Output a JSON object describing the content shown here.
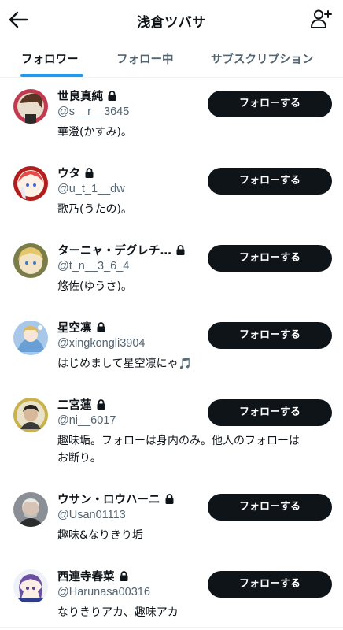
{
  "header": {
    "title": "浅倉ツバサ",
    "back_icon": "arrow-left-icon",
    "add_icon": "person-add-icon"
  },
  "tabs": [
    {
      "label": "フォロワー",
      "active": true
    },
    {
      "label": "フォロー中",
      "active": false
    },
    {
      "label": "サブスクリプション",
      "active": false
    }
  ],
  "colors": {
    "accent": "#1d9bf0",
    "button_bg": "#0f1419",
    "secondary_text": "#536471"
  },
  "users": [
    {
      "name": "世良真純",
      "handle": "@s__r__3645",
      "bio": [
        "華澄(かすみ)。"
      ],
      "button": "フォローする",
      "protected": true
    },
    {
      "name": "ウタ",
      "handle": "@u_t_1__dw",
      "bio": [
        "歌乃(うたの)。"
      ],
      "button": "フォローする",
      "protected": true
    },
    {
      "name": "ターニャ・デグレチ…",
      "handle": "@t_n__3_6_4",
      "bio": [
        "悠佐(ゆうさ)。"
      ],
      "button": "フォローする",
      "protected": true
    },
    {
      "name": "星空凛",
      "handle": "@xingkongli3904",
      "bio": [
        "はじめまして星空凛にゃ🎵"
      ],
      "button": "フォローする",
      "protected": true
    },
    {
      "name": "二宮蓮",
      "handle": "@ni__6017",
      "bio": [
        "趣味垢。フォローは身内のみ。他人のフォローは",
        "お断り。"
      ],
      "button": "フォローする",
      "protected": true
    },
    {
      "name": "ウサン・ロウハーニ",
      "handle": "@Usan01113",
      "bio": [
        "趣味&なりきり垢"
      ],
      "button": "フォローする",
      "protected": true
    },
    {
      "name": "西連寺春菜",
      "handle": "@Harunasa00316",
      "bio": [
        "なりきりアカ、趣味アカ"
      ],
      "button": "フォローする",
      "protected": true
    }
  ]
}
